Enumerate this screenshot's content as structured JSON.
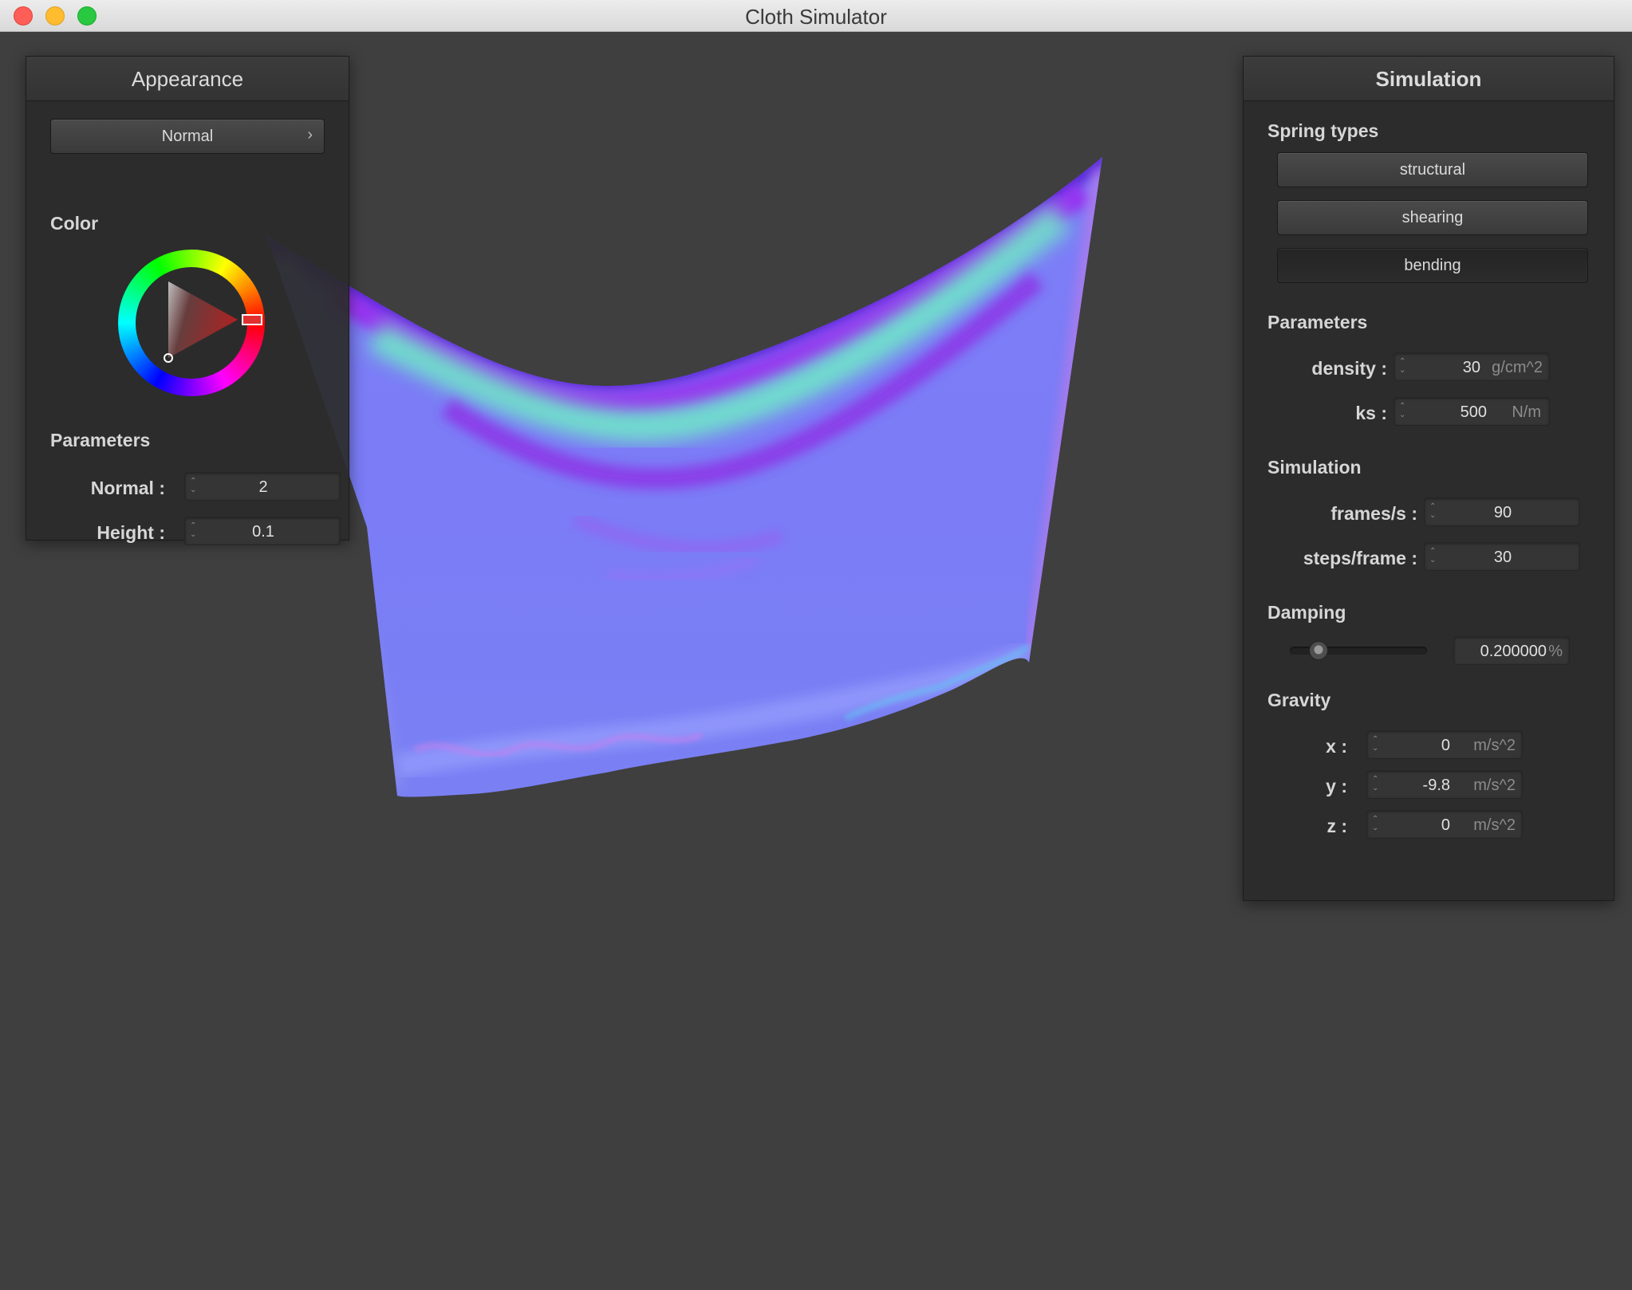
{
  "window": {
    "title": "Cloth Simulator"
  },
  "appearance": {
    "title": "Appearance",
    "shader_dropdown": "Normal",
    "shader_chevron": "›",
    "color_label": "Color",
    "color_wheel_icon": "color-wheel",
    "parameters_label": "Parameters",
    "normal": {
      "label": "Normal :",
      "value": "2"
    },
    "height": {
      "label": "Height :",
      "value": "0.1"
    }
  },
  "simulation": {
    "title": "Simulation",
    "spring_types_label": "Spring types",
    "springs": [
      {
        "label": "structural",
        "pressed": false
      },
      {
        "label": "shearing",
        "pressed": false
      },
      {
        "label": "bending",
        "pressed": true
      }
    ],
    "parameters_label": "Parameters",
    "density": {
      "label": "density :",
      "value": "30",
      "unit": "g/cm^2"
    },
    "ks": {
      "label": "ks :",
      "value": "500",
      "unit": "N/m"
    },
    "simulation_label": "Simulation",
    "frames_per_second": {
      "label": "frames/s :",
      "value": "90"
    },
    "steps_per_frame": {
      "label": "steps/frame :",
      "value": "30"
    },
    "damping_label": "Damping",
    "damping": {
      "value": "0.200000",
      "unit": "%",
      "slider_fraction": 0.2
    },
    "gravity_label": "Gravity",
    "gravity_x": {
      "label": "x :",
      "value": "0",
      "unit": "m/s^2"
    },
    "gravity_y": {
      "label": "y :",
      "value": "-9.8",
      "unit": "m/s^2"
    },
    "gravity_z": {
      "label": "z :",
      "value": "0",
      "unit": "m/s^2"
    }
  },
  "colors": {
    "background": "#3f3f3f",
    "cloth_base": "#7a7bf6",
    "cloth_fold_purple": "#8a2fe8",
    "cloth_fold_green": "#6ee8c0",
    "selected_color": "#e03030"
  }
}
